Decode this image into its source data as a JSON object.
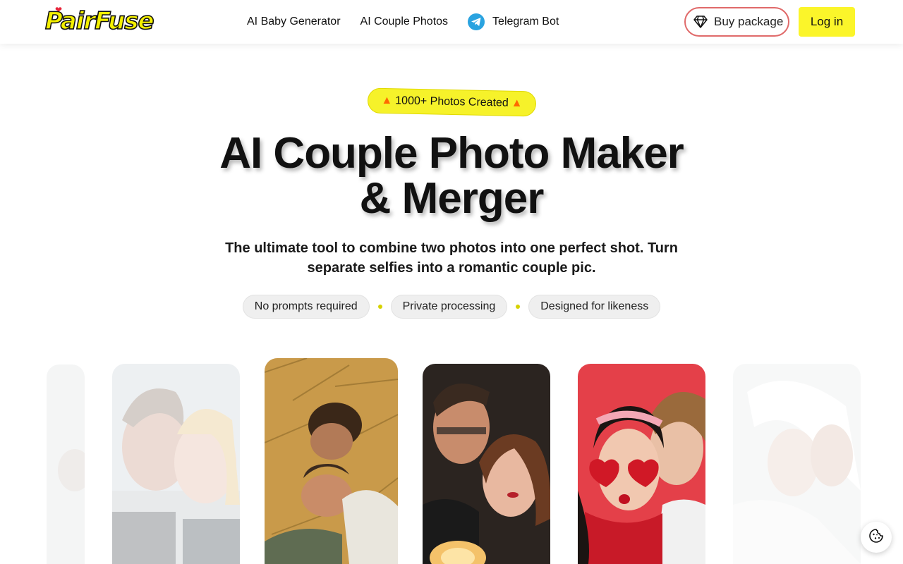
{
  "header": {
    "logo_text": "PairFuse",
    "nav": [
      {
        "label": "AI Baby Generator"
      },
      {
        "label": "AI Couple Photos"
      },
      {
        "label": "Telegram Bot",
        "icon": "telegram-icon"
      }
    ],
    "buy_label": "Buy package",
    "buy_icon": "diamond-icon",
    "login_label": "Log in",
    "accent_color": "#fbf52a"
  },
  "hero": {
    "badge_text": "1000+ Photos Created",
    "badge_icon": "fire-icon",
    "title_line1": "AI Couple Photo Maker",
    "title_line2": "& Merger",
    "subtitle": "The ultimate tool to combine two photos into one perfect shot. Turn separate selfies into a romantic couple pic.",
    "features": [
      "No prompts required",
      "Private processing",
      "Designed for likeness"
    ]
  },
  "gallery": {
    "images": [
      {
        "name": "couple-photo-snow"
      },
      {
        "name": "couple-photo-hay"
      },
      {
        "name": "couple-photo-night"
      },
      {
        "name": "couple-photo-heart-glasses"
      },
      {
        "name": "couple-photo-white"
      }
    ]
  },
  "cookie_icon": "cookie-icon"
}
